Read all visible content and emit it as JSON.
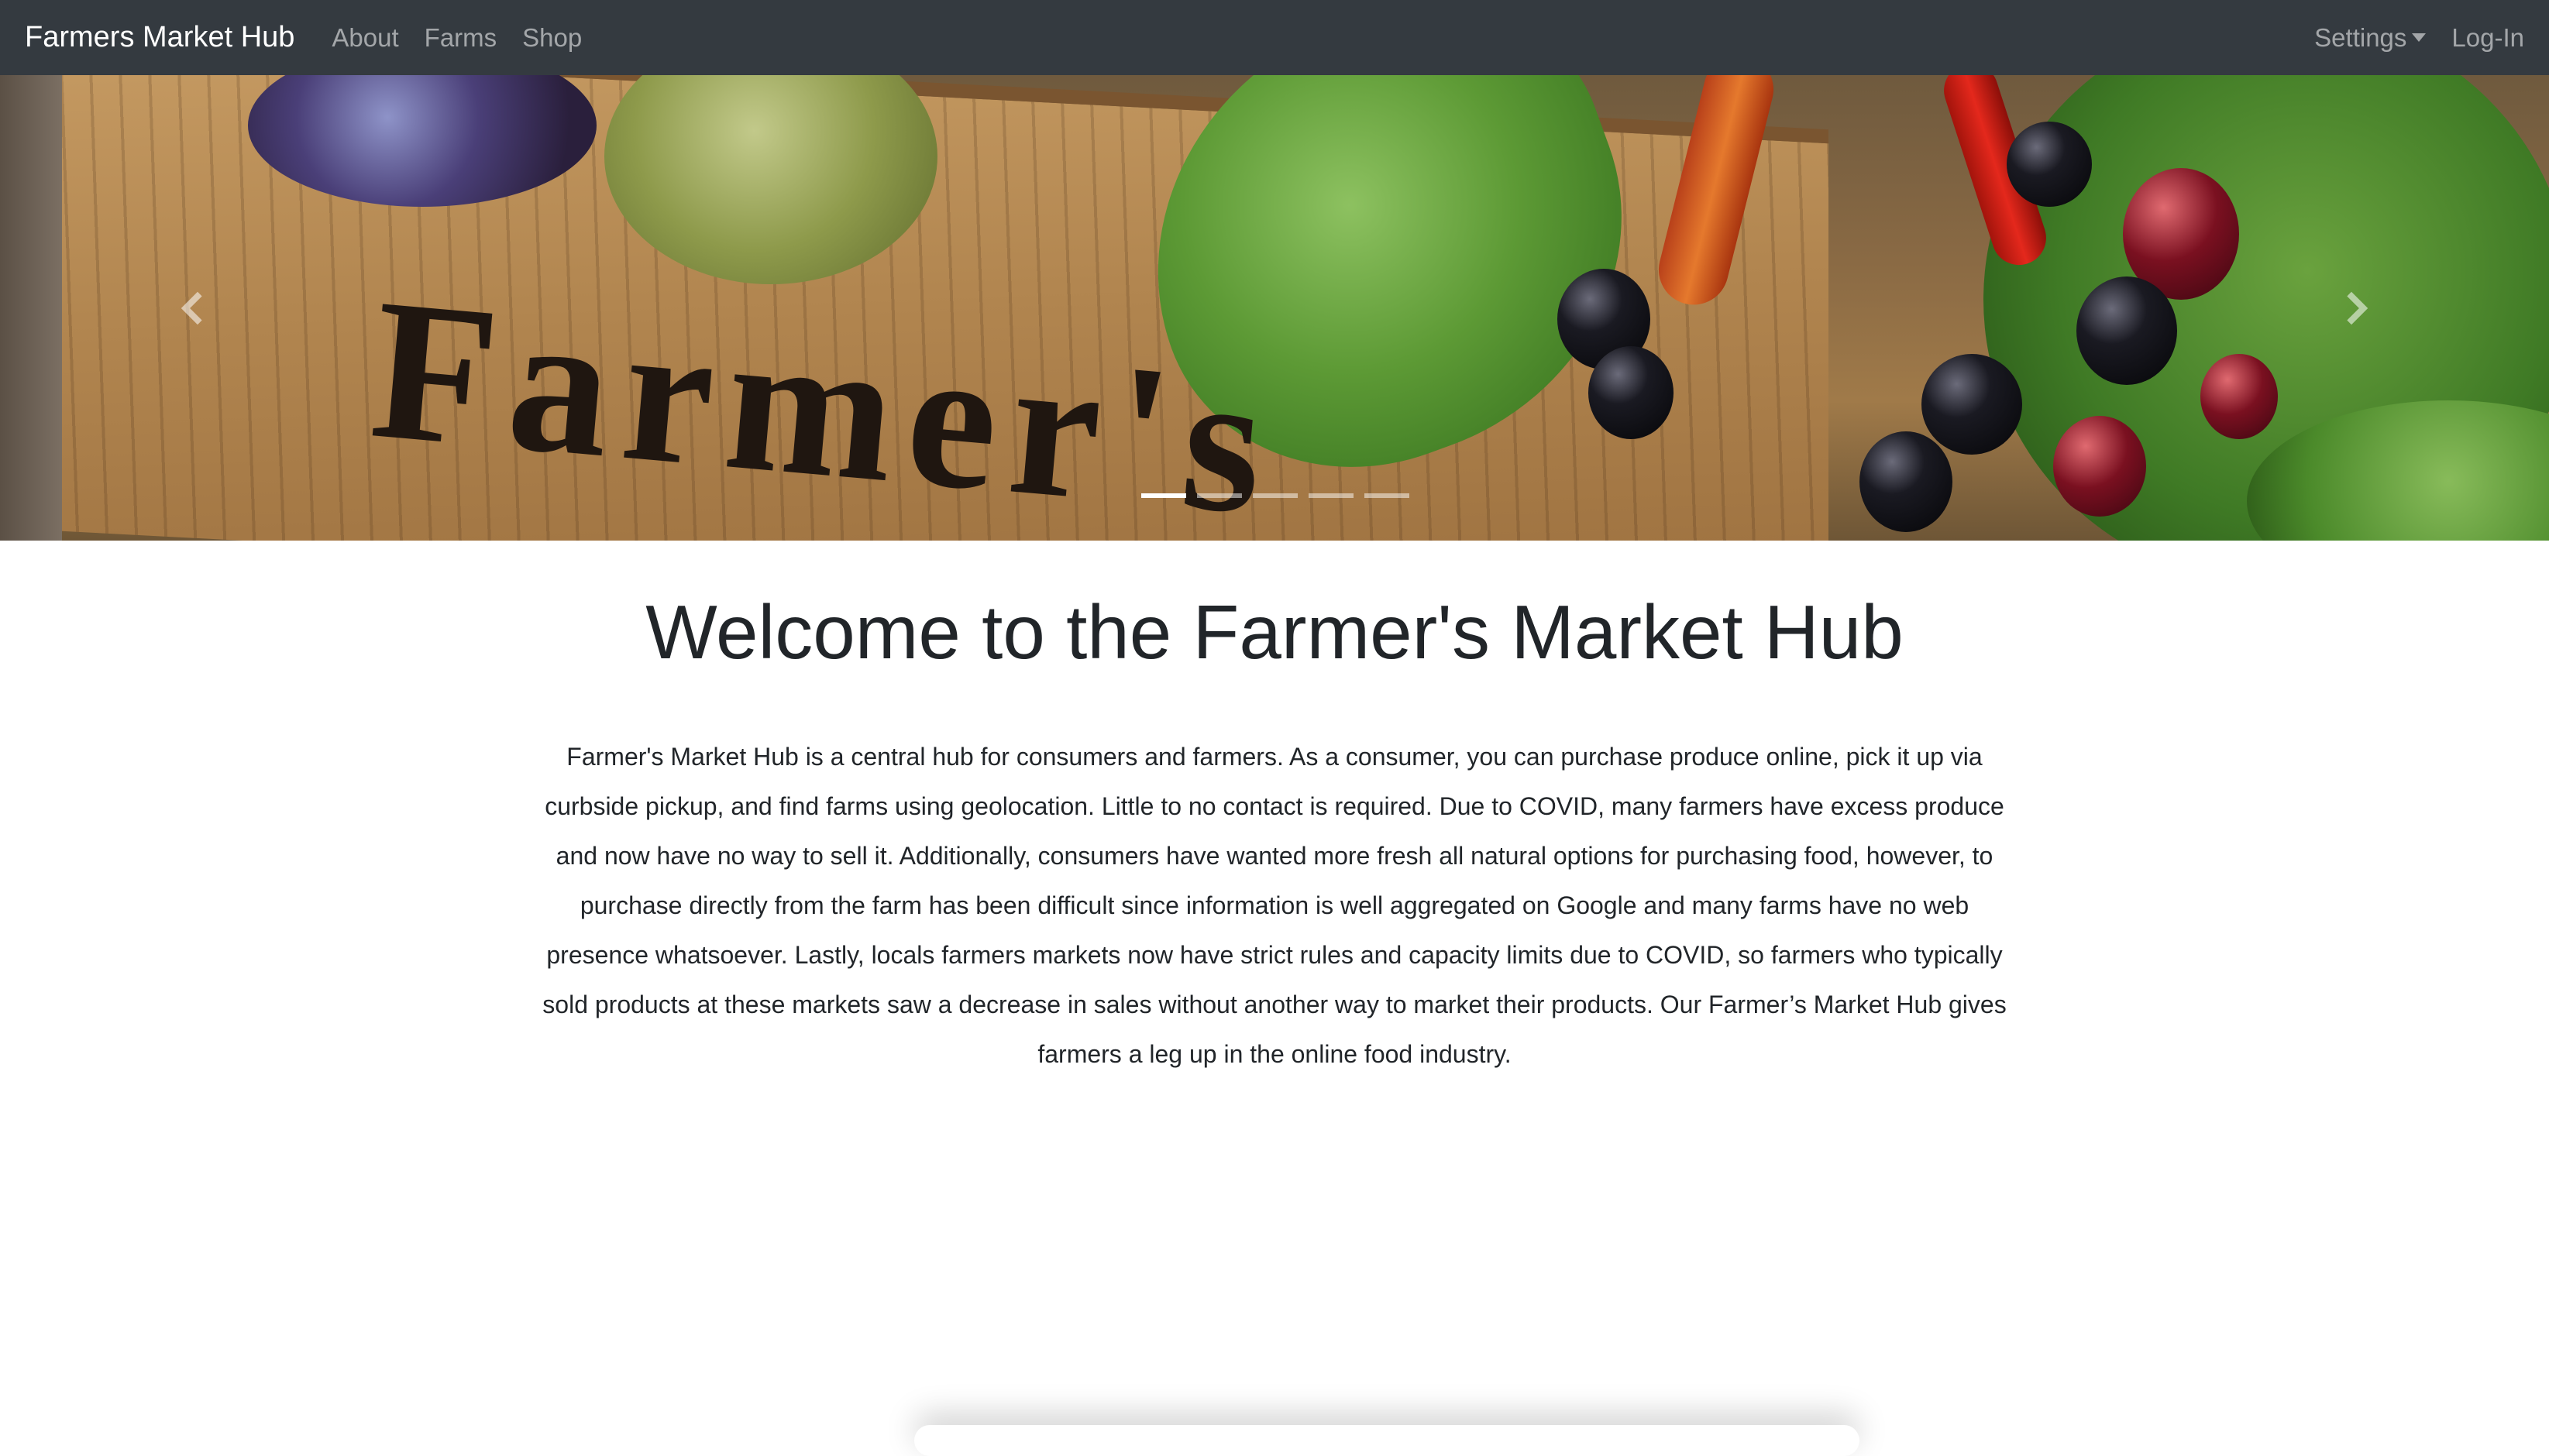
{
  "navbar": {
    "brand": "Farmers Market Hub",
    "links": [
      "About",
      "Farms",
      "Shop"
    ],
    "settings_label": "Settings",
    "login_label": "Log-In"
  },
  "carousel": {
    "image_text": "Farmer's",
    "slide_count": 5,
    "active_slide": 1
  },
  "main": {
    "title": "Welcome to the Farmer's Market Hub",
    "intro": "Farmer's Market Hub is a central hub for consumers and farmers. As a consumer, you can purchase produce online, pick it up via curbside pickup, and find farms using geolocation. Little to no contact is required. Due to COVID, many farmers have excess produce and now have no way to sell it. Additionally, consumers have wanted more fresh all natural options for purchasing food, however, to purchase directly from the farm has been difficult since information is well aggregated on Google and many farms have no web presence whatsoever. Lastly, locals farmers markets now have strict rules and capacity limits due to COVID, so farmers who typically sold products at these markets saw a decrease in sales without another way to market their products. Our Farmer’s Market Hub gives farmers a leg up in the online food industry."
  },
  "icons": {
    "prev": "chevron-left-icon",
    "next": "chevron-right-icon",
    "settings_caret": "caret-down-icon"
  },
  "colors": {
    "navbar_bg": "#343a40",
    "brand_text": "#ffffff",
    "nav_link": "rgba(255,255,255,0.55)",
    "body_text": "#212529"
  }
}
